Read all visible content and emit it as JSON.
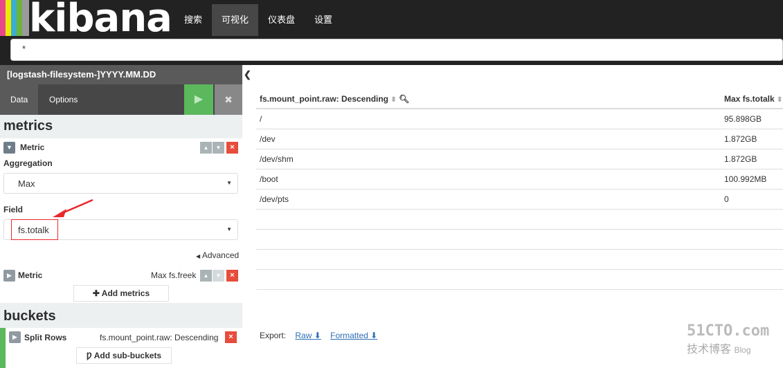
{
  "app": {
    "logo_text": "kibana",
    "logo_stripe_colors": [
      "#e8488b",
      "#ebeb00",
      "#3caed2",
      "#6db33f",
      "#9a9a9a"
    ]
  },
  "nav": {
    "items": [
      "搜索",
      "可视化",
      "仪表盘",
      "设置"
    ],
    "active": "可视化"
  },
  "query": {
    "value": "*"
  },
  "sidebar": {
    "index_pattern": "[logstash-filesystem-]YYYY.MM.DD",
    "tabs": {
      "data": "Data",
      "options": "Options"
    },
    "play_icon": "▶",
    "clear_icon": "✖",
    "metrics_title": "metrics",
    "metric1": {
      "name": "Metric",
      "aggregation_label": "Aggregation",
      "aggregation_value": "Max",
      "field_label": "Field",
      "field_value": "fs.totalk",
      "advanced_label": "Advanced"
    },
    "metric2": {
      "name": "Metric",
      "summary": "Max fs.freek"
    },
    "add_metrics_label": "Add metrics",
    "buckets_title": "buckets",
    "bucket1": {
      "name": "Split Rows",
      "summary": "fs.mount_point.raw: Descending"
    },
    "add_sub_buckets_label": "Add sub-buckets"
  },
  "table": {
    "columns": [
      "fs.mount_point.raw: Descending",
      "Max fs.totalk"
    ],
    "rows": [
      [
        "/",
        "95.898GB"
      ],
      [
        "/dev",
        "1.872GB"
      ],
      [
        "/dev/shm",
        "1.872GB"
      ],
      [
        "/boot",
        "100.992MB"
      ],
      [
        "/dev/pts",
        "0"
      ]
    ]
  },
  "export": {
    "label": "Export:",
    "raw": "Raw",
    "formatted": "Formatted"
  },
  "watermark": {
    "site": "51CTO.com",
    "sub": "技术博客",
    "blog": "Blog"
  },
  "colors": {
    "accent_green": "#5cb85c",
    "delete_red": "#e74c3c",
    "link_blue": "#2d6eb5",
    "annotation_red": "#e8282b"
  }
}
